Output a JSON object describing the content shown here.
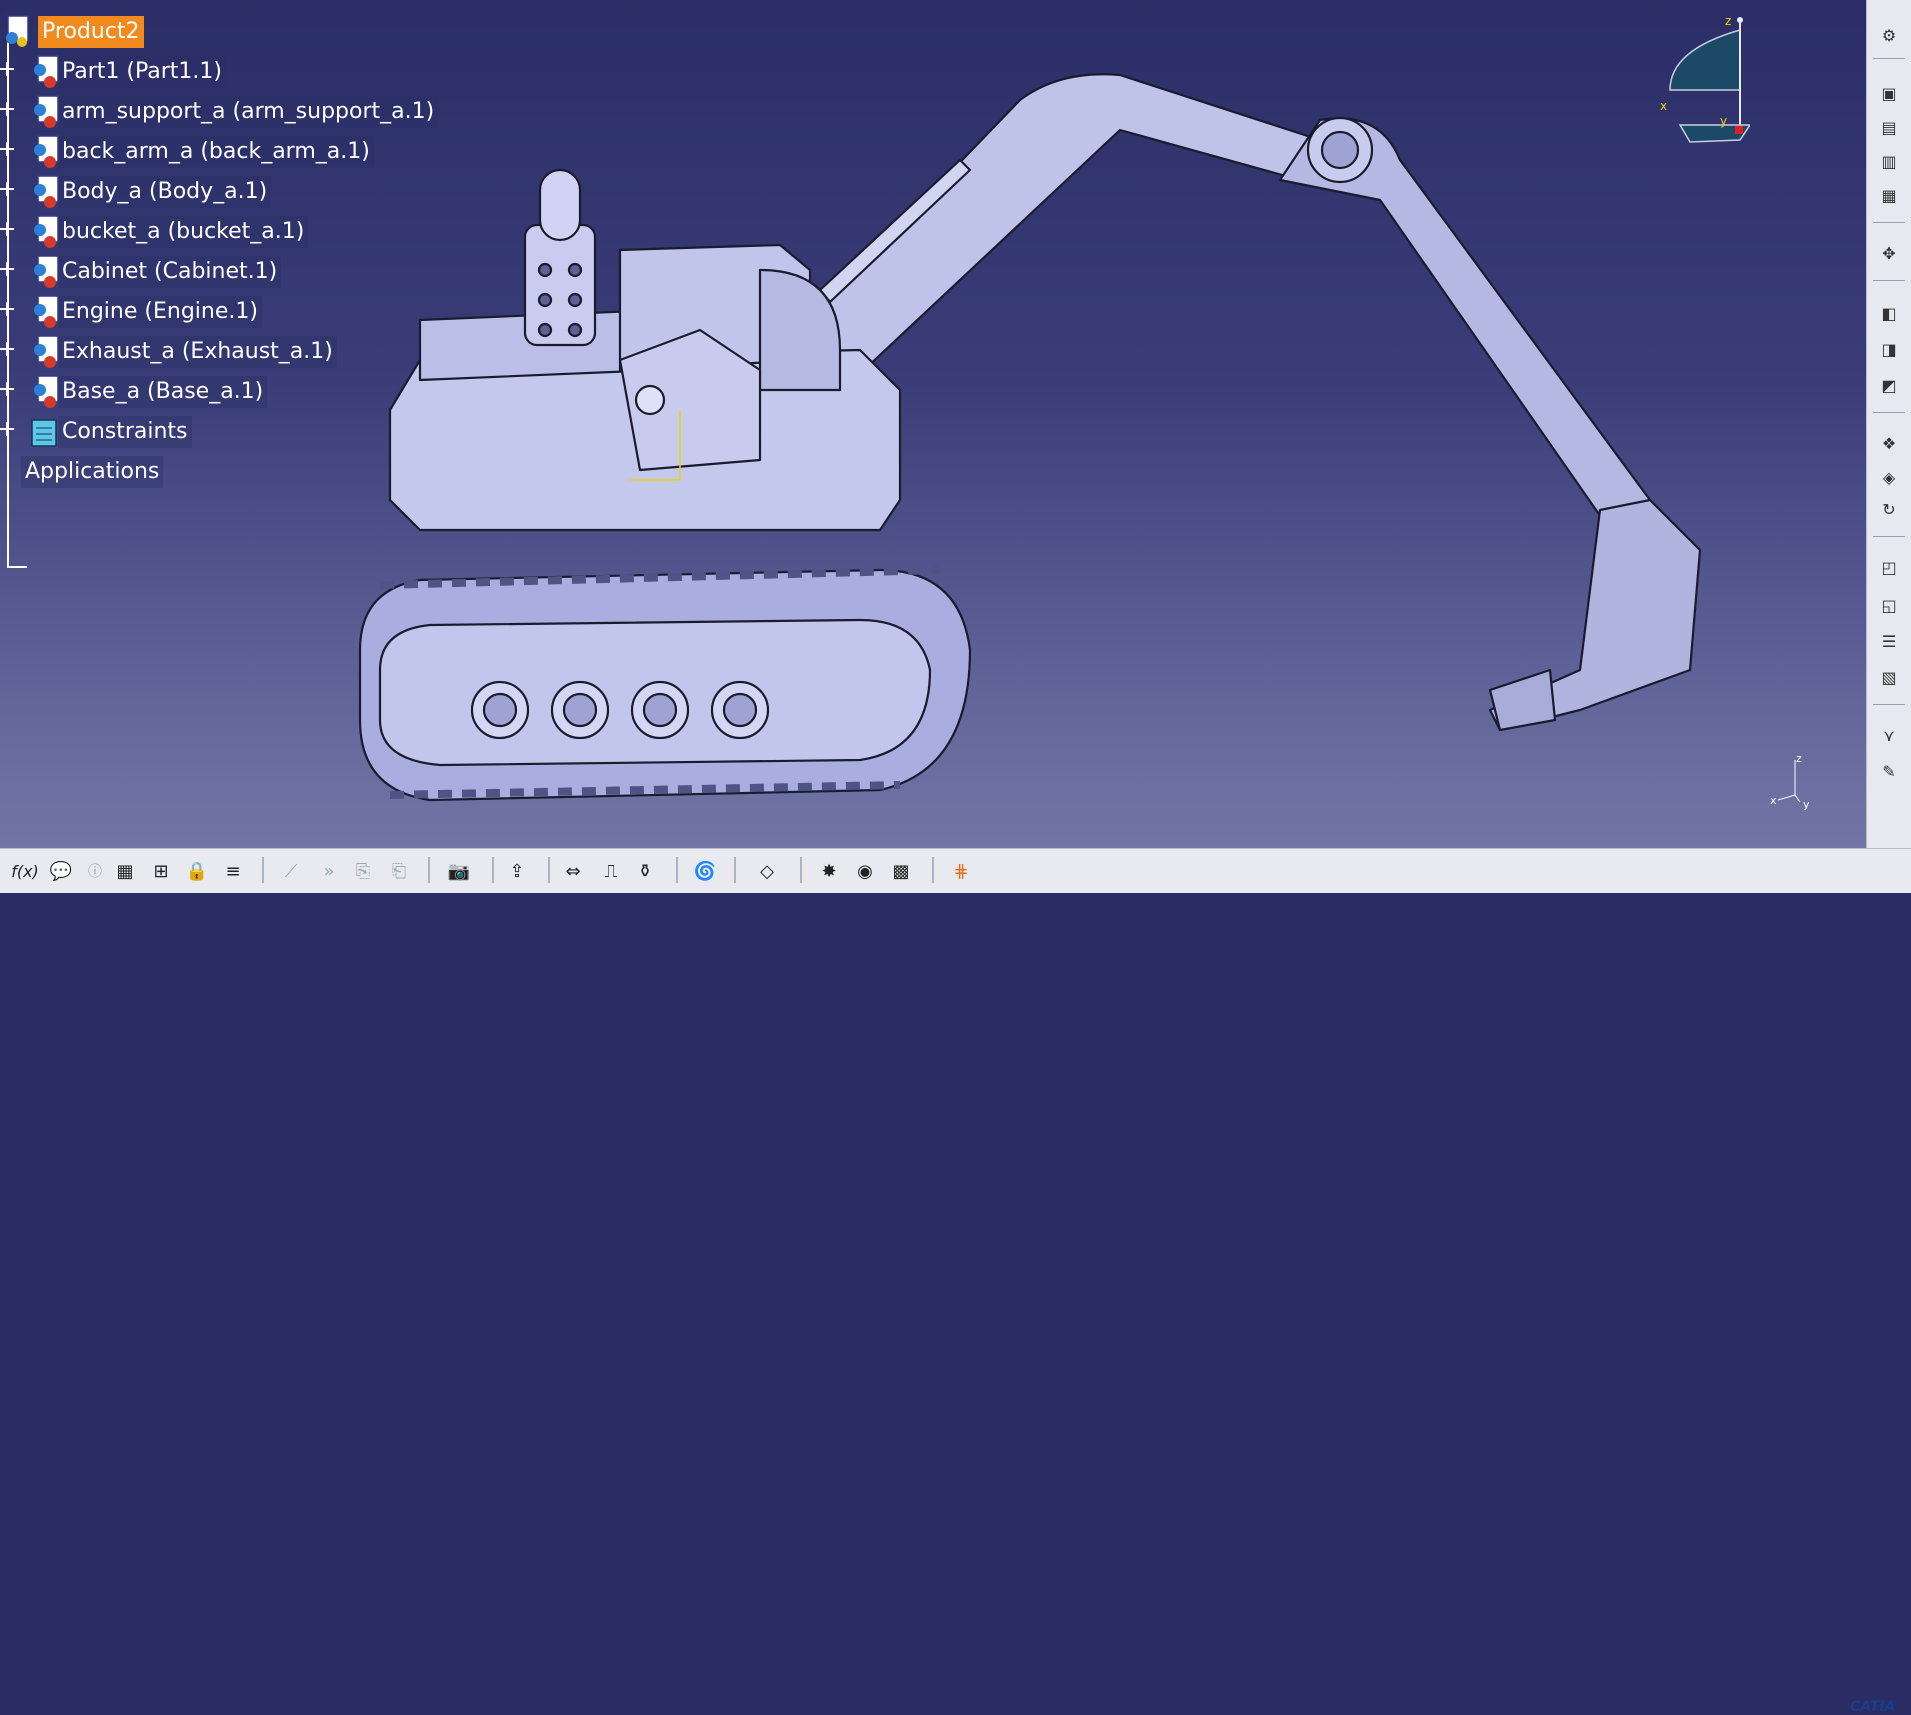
{
  "tree": {
    "root": "Product2",
    "items": [
      {
        "label": "Part1 (Part1.1)"
      },
      {
        "label": "arm_support_a (arm_support_a.1)"
      },
      {
        "label": "back_arm_a (back_arm_a.1)"
      },
      {
        "label": "Body_a (Body_a.1)"
      },
      {
        "label": "bucket_a (bucket_a.1)"
      },
      {
        "label": "Cabinet (Cabinet.1)"
      },
      {
        "label": "Engine (Engine.1)"
      },
      {
        "label": "Exhaust_a (Exhaust_a.1)"
      },
      {
        "label": "Base_a (Base_a.1)"
      }
    ],
    "constraints": "Constraints",
    "applications": "Applications"
  },
  "compass": {
    "z": "z",
    "x": "x",
    "y": "y"
  },
  "axis_mini": {
    "z": "z",
    "x": "x",
    "y": "y"
  },
  "bottom_toolbar": {
    "formula": "f(x)"
  },
  "logo": {
    "text": "CATIA"
  },
  "colors": {
    "selection": "#f28a1e",
    "part_fill": "#b9bde6",
    "background_top": "#2b2e66",
    "background_bottom": "#7276a6"
  }
}
